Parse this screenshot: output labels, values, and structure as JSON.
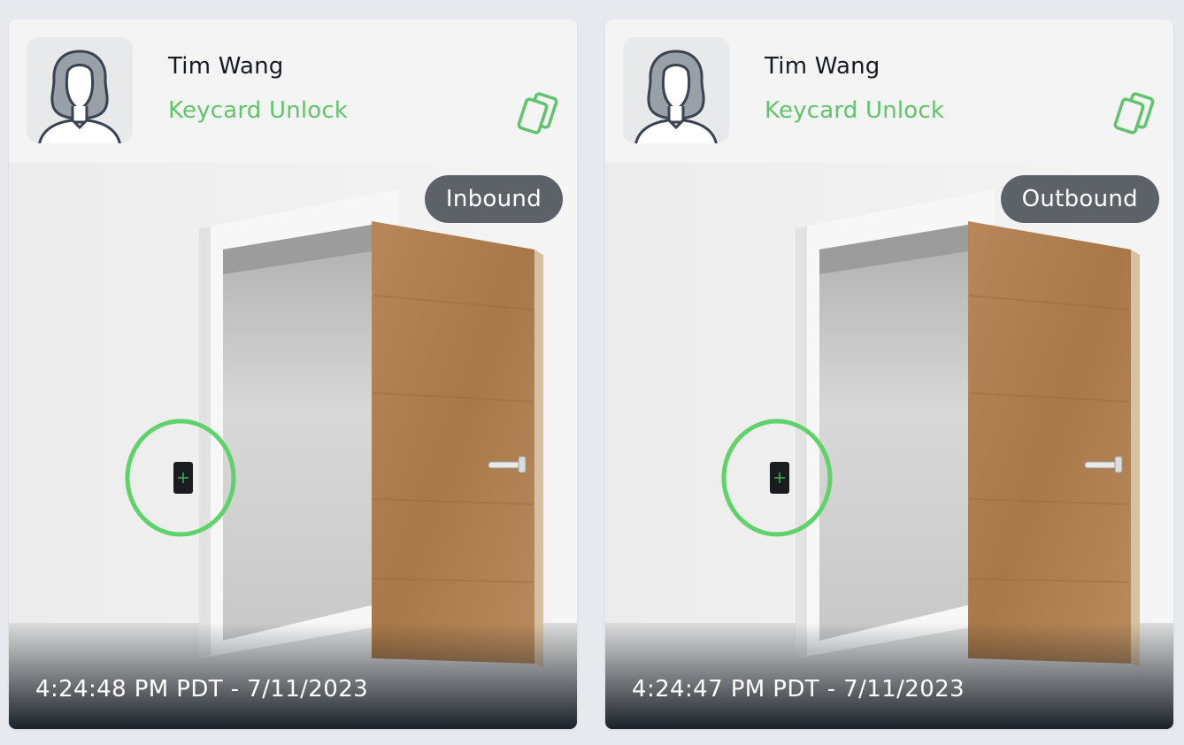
{
  "events": [
    {
      "user_name": "Tim Wang",
      "event_type": "Keycard Unlock",
      "direction": "Inbound",
      "timestamp": "4:24:48 PM PDT - 7/11/2023"
    },
    {
      "user_name": "Tim Wang",
      "event_type": "Keycard Unlock",
      "direction": "Outbound",
      "timestamp": "4:24:47 PM PDT - 7/11/2023"
    }
  ],
  "icons": {
    "avatar": "person-silhouette-icon",
    "event": "keycard-icon",
    "reader": "card-reader-icon"
  },
  "colors": {
    "accent_green": "#5fc46a",
    "badge_bg": "#5d6168",
    "page_bg": "#e6e9ed"
  }
}
